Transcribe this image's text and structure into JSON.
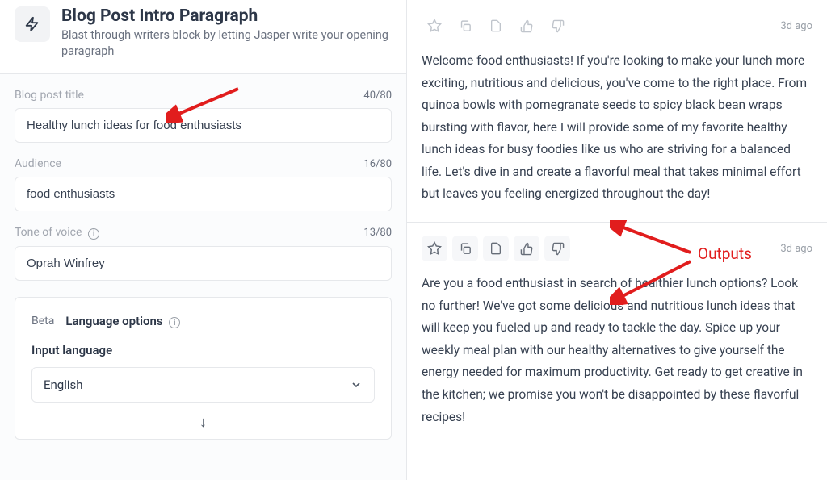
{
  "header": {
    "title": "Blog Post Intro Paragraph",
    "subtitle": "Blast through writers block by letting Jasper write your opening paragraph"
  },
  "fields": {
    "title": {
      "label": "Blog post title",
      "count": "40/80",
      "value": "Healthy lunch ideas for food enthusiasts"
    },
    "audience": {
      "label": "Audience",
      "count": "16/80",
      "value": "food enthusiasts"
    },
    "tone": {
      "label": "Tone of voice",
      "count": "13/80",
      "value": "Oprah Winfrey"
    }
  },
  "lang": {
    "beta": "Beta",
    "options": "Language options",
    "input_label": "Input language",
    "input_value": "English"
  },
  "outputs": [
    {
      "time": "3d ago",
      "text": "Welcome food enthusiasts! If you're looking to make your lunch more exciting, nutritious and delicious, you've come to the right place. From quinoa bowls with pomegranate seeds to spicy black bean wraps bursting with flavor, here I will provide some of my favorite healthy lunch ideas for busy foodies like us who are striving for a balanced life. Let's dive in and create a flavorful meal that takes minimal effort but leaves you feeling energized throughout the day!"
    },
    {
      "time": "3d ago",
      "text": "Are you a food enthusiast in search of healthier lunch options? Look no further! We've got some delicious and nutritious lunch ideas that will keep you fueled up and ready to tackle the day. Spice up your weekly meal plan with our healthy alternatives to give yourself the energy needed for maximum productivity. Get ready to get creative in the kitchen; we promise you won't be disappointed by these flavorful recipes!"
    }
  ],
  "annotations": {
    "outputs_label": "Outputs"
  }
}
